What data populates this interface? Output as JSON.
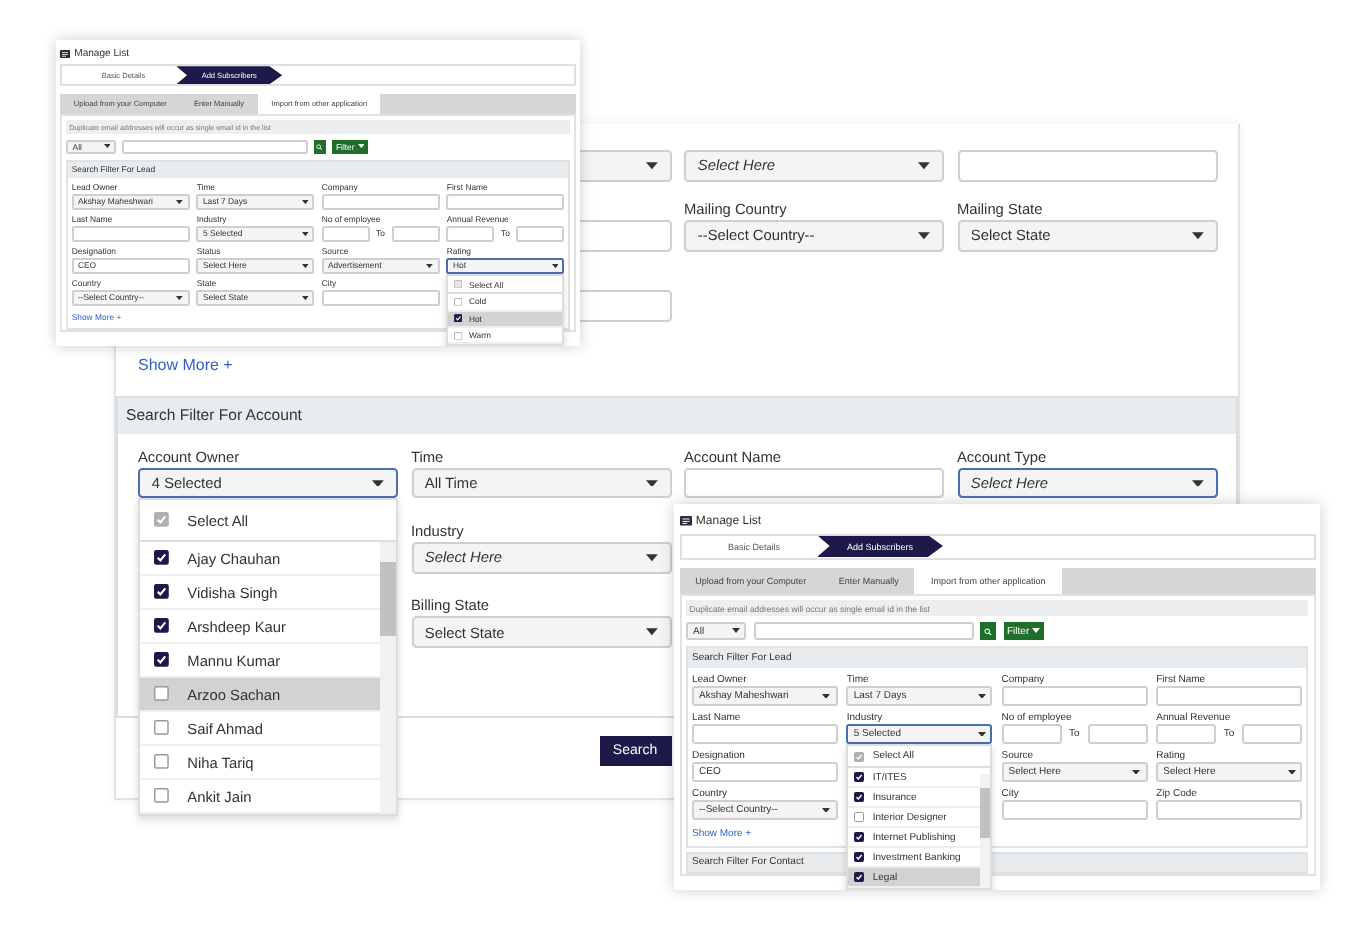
{
  "main_panel": {
    "upper_rows": [
      [
        null,
        {
          "kind": "select",
          "focused": false
        },
        {
          "kind": "select",
          "placeholder": "Select Here",
          "focused": false
        },
        {
          "kind": "text",
          "focused": false
        }
      ],
      [
        null,
        {
          "kind": "text",
          "focused": false
        },
        {
          "label": "Mailing Country",
          "kind": "select",
          "value": "--Select Country--",
          "focused": false
        },
        {
          "label": "Mailing State",
          "kind": "select",
          "value": "Select State",
          "focused": false
        }
      ],
      [
        null,
        {
          "kind": "text",
          "focused": false
        },
        null,
        null
      ]
    ],
    "show_more": "Show More +",
    "account_filter": {
      "title": "Search Filter For Account",
      "rows": [
        [
          {
            "label": "Account Owner",
            "kind": "select",
            "value": "4 Selected",
            "focused": true,
            "options": [
              {
                "label": "Select All",
                "kind": "all",
                "checked": true,
                "selected": false
              },
              {
                "label": "Ajay Chauhan",
                "kind": "option",
                "checked": true,
                "selected": false
              },
              {
                "label": "Vidisha Singh",
                "kind": "option",
                "checked": true,
                "selected": false
              },
              {
                "label": "Arshdeep Kaur",
                "kind": "option",
                "checked": true,
                "selected": false
              },
              {
                "label": "Mannu Kumar",
                "kind": "option",
                "checked": true,
                "selected": false
              },
              {
                "label": "Arzoo Sachan",
                "kind": "option",
                "checked": false,
                "selected": true
              },
              {
                "label": "Saif Ahmad",
                "kind": "option",
                "checked": false,
                "selected": false
              },
              {
                "label": "Niha Tariq",
                "kind": "option",
                "checked": false,
                "selected": false
              },
              {
                "label": "Ankit Jain",
                "kind": "option",
                "checked": false,
                "selected": false
              }
            ]
          },
          {
            "label": "Time",
            "kind": "select",
            "value": "All Time",
            "focused": false
          },
          {
            "label": "Account Name",
            "kind": "text",
            "focused": false
          },
          {
            "label": "Account Type",
            "kind": "select",
            "placeholder": "Select Here",
            "focused": true
          }
        ],
        [
          null,
          {
            "label": "Industry",
            "kind": "select",
            "placeholder": "Select Here",
            "focused": false
          },
          null,
          null
        ],
        [
          null,
          {
            "label": "Billing State",
            "kind": "select",
            "value": "Select State",
            "focused": false
          },
          null,
          null
        ]
      ]
    },
    "search_button": "Search"
  },
  "windows": [
    {
      "title": "Manage List",
      "steps": [
        {
          "label": "Basic Details",
          "selected": false
        },
        {
          "label": "Add Subscribers",
          "selected": true
        }
      ],
      "tabs": [
        {
          "label": "Upload from your Computer",
          "selected": false
        },
        {
          "label": "Enter Manually",
          "selected": false
        },
        {
          "label": "Import from other application",
          "selected": true
        }
      ],
      "note": "Duplicate email addresses will occur as single email id in the list",
      "search": {
        "scope": "All",
        "filter_button": "Filter"
      },
      "section": "Search Filter For Lead",
      "rows": [
        [
          {
            "label": "Lead Owner",
            "kind": "select",
            "value": "Akshay Maheshwari",
            "focused": false
          },
          {
            "label": "Time",
            "kind": "select",
            "value": "Last 7 Days",
            "focused": false
          },
          {
            "label": "Company",
            "kind": "text",
            "focused": false
          },
          {
            "label": "First Name",
            "kind": "text",
            "focused": false
          }
        ],
        [
          {
            "label": "Last Name",
            "kind": "text",
            "focused": false
          },
          {
            "label": "Industry",
            "kind": "select",
            "value": "5 Selected",
            "focused": false
          },
          {
            "label": "No of employee",
            "kind": "range",
            "separator": "To",
            "focused": false
          },
          {
            "label": "Annual Revenue",
            "kind": "range",
            "separator": "To",
            "focused": false
          }
        ],
        [
          {
            "label": "Designation",
            "kind": "text",
            "value": "CEO",
            "focused": false
          },
          {
            "label": "Status",
            "kind": "select",
            "value": "Select Here",
            "focused": false
          },
          {
            "label": "Source",
            "kind": "select",
            "value": "Advertisement",
            "focused": false
          },
          {
            "label": "Rating",
            "kind": "select",
            "value": "Hot",
            "focused": true,
            "options": [
              {
                "label": "Select All",
                "kind": "all",
                "checked": false,
                "selected": false
              },
              {
                "label": "Cold",
                "kind": "option",
                "checked": false,
                "selected": false
              },
              {
                "label": "Hot",
                "kind": "option",
                "checked": true,
                "selected": true
              },
              {
                "label": "Warm",
                "kind": "option",
                "checked": false,
                "selected": false
              }
            ]
          }
        ],
        [
          {
            "label": "Country",
            "kind": "select",
            "value": "--Select Country--",
            "focused": false
          },
          {
            "label": "State",
            "kind": "select",
            "value": "Select State",
            "focused": false
          },
          {
            "label": "City",
            "kind": "text",
            "focused": false
          },
          null
        ]
      ],
      "show_more": "Show More +"
    },
    {
      "title": "Manage List",
      "steps": [
        {
          "label": "Basic Details",
          "selected": false
        },
        {
          "label": "Add Subscribers",
          "selected": true
        }
      ],
      "tabs": [
        {
          "label": "Upload from your Computer",
          "selected": false
        },
        {
          "label": "Enter Manually",
          "selected": false
        },
        {
          "label": "Import from other application",
          "selected": true
        }
      ],
      "note": "Duplicate email addresses will occur as single email id in the list",
      "search": {
        "scope": "All",
        "filter_button": "Filter"
      },
      "section": "Search Filter For Lead",
      "rows": [
        [
          {
            "label": "Lead Owner",
            "kind": "select",
            "value": "Akshay Maheshwari",
            "focused": false
          },
          {
            "label": "Time",
            "kind": "select",
            "value": "Last 7 Days",
            "focused": false
          },
          {
            "label": "Company",
            "kind": "text",
            "focused": false
          },
          {
            "label": "First Name",
            "kind": "text",
            "focused": false
          }
        ],
        [
          {
            "label": "Last Name",
            "kind": "text",
            "focused": false
          },
          {
            "label": "Industry",
            "kind": "select",
            "value": "5 Selected",
            "focused": true,
            "options": [
              {
                "label": "Select All",
                "kind": "all",
                "checked": true,
                "selected": false
              },
              {
                "label": "IT/ITES",
                "kind": "option",
                "checked": true,
                "selected": false
              },
              {
                "label": "Insurance",
                "kind": "option",
                "checked": true,
                "selected": false
              },
              {
                "label": "Interior Designer",
                "kind": "option",
                "checked": false,
                "selected": false
              },
              {
                "label": "Internet Publishing",
                "kind": "option",
                "checked": true,
                "selected": false
              },
              {
                "label": "Investment Banking",
                "kind": "option",
                "checked": true,
                "selected": false
              },
              {
                "label": "Legal",
                "kind": "option",
                "checked": true,
                "selected": true
              }
            ]
          },
          {
            "label": "No of employee",
            "kind": "range",
            "separator": "To",
            "focused": false
          },
          {
            "label": "Annual Revenue",
            "kind": "range",
            "separator": "To",
            "focused": false
          }
        ],
        [
          {
            "label": "Designation",
            "kind": "text",
            "value": "CEO",
            "focused": false
          },
          null,
          {
            "label": "Source",
            "kind": "select",
            "value": "Select Here",
            "focused": false
          },
          {
            "label": "Rating",
            "kind": "select",
            "value": "Select Here",
            "focused": false
          }
        ],
        [
          {
            "label": "Country",
            "kind": "select",
            "value": "--Select Country--",
            "focused": false
          },
          null,
          {
            "label": "City",
            "kind": "text",
            "focused": false
          },
          {
            "label": "Zip Code",
            "kind": "text",
            "focused": false
          }
        ]
      ],
      "show_more": "Show More +",
      "next_section": "Search Filter For Contact"
    }
  ]
}
